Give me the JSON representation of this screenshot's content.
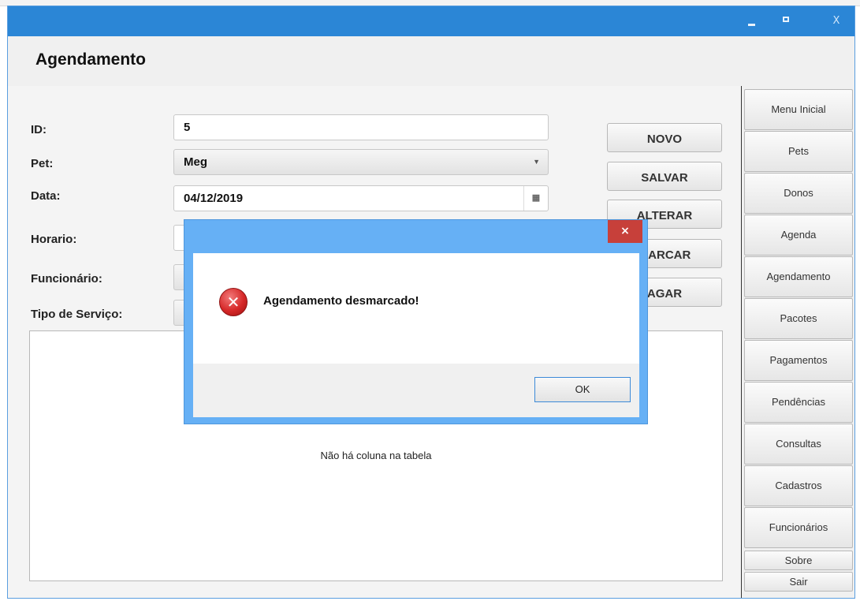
{
  "window": {
    "minimize_glyph": "",
    "maximize_glyph": "",
    "close_glyph": "X"
  },
  "page": {
    "title": "Agendamento"
  },
  "form": {
    "id": {
      "label": "ID:",
      "value": "5"
    },
    "pet": {
      "label": "Pet:",
      "value": "Meg"
    },
    "data": {
      "label": "Data:",
      "value": "04/12/2019"
    },
    "horario": {
      "label": "Horario:",
      "value": ""
    },
    "funcionario": {
      "label": "Funcionário:",
      "value": ""
    },
    "tipo_servico": {
      "label": "Tipo de Serviço:",
      "value": ""
    }
  },
  "actions": {
    "novo": "NOVO",
    "salvar": "SALVAR",
    "alterar": "ALTERAR",
    "desmarcar_visible": "MARCAR",
    "apagar_visible": "AGAR"
  },
  "table": {
    "empty_message": "Não há coluna na tabela"
  },
  "sidebar": {
    "items": [
      {
        "label": "Menu Inicial"
      },
      {
        "label": "Pets"
      },
      {
        "label": "Donos"
      },
      {
        "label": "Agenda"
      },
      {
        "label": "Agendamento"
      },
      {
        "label": "Pacotes"
      },
      {
        "label": "Pagamentos"
      },
      {
        "label": "Pendências"
      },
      {
        "label": "Consultas"
      },
      {
        "label": "Cadastros"
      },
      {
        "label": "Funcionários"
      },
      {
        "label": "Sobre"
      },
      {
        "label": "Sair"
      }
    ]
  },
  "dialog": {
    "message": "Agendamento desmarcado!",
    "ok_label": "OK",
    "close_glyph": "×",
    "icon": "error-icon"
  },
  "colors": {
    "titlebar": "#2b86d6",
    "dialog_frame": "#66b0f5",
    "dialog_close": "#c7403a",
    "error_icon": "#d62828"
  }
}
